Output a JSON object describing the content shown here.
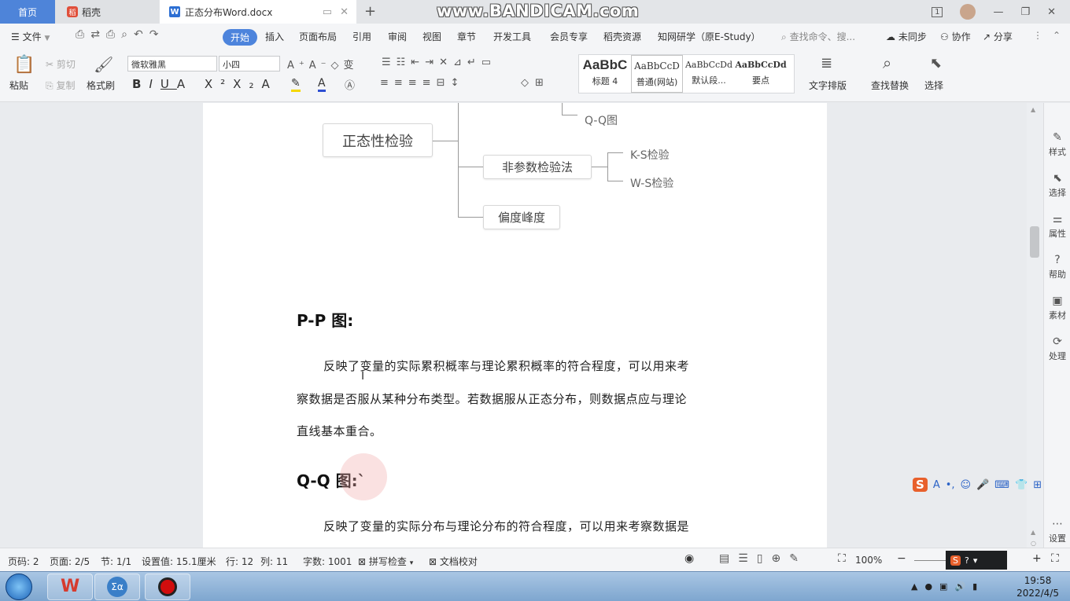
{
  "titlebar": {
    "tab_home": "首页",
    "tab_daoke": "稻壳",
    "tab_doc": "正态分布Word.docx",
    "tab_add": "+",
    "watermark": "www.BANDICAM.com",
    "window_controls": {
      "pages": "1",
      "minimize": "—",
      "restore": "❐",
      "close": "✕"
    }
  },
  "menu": {
    "file": "文件",
    "items": [
      "开始",
      "插入",
      "页面布局",
      "引用",
      "审阅",
      "视图",
      "章节",
      "开发工具",
      "会员专享",
      "稻壳资源",
      "知网研学（原E-Study）"
    ],
    "search": "查找命令、搜...",
    "unsync": "未同步",
    "collab": "协作",
    "share": "分享"
  },
  "ribbon": {
    "paste": "粘贴",
    "cut": "剪切",
    "copy": "复制",
    "format_painter": "格式刷",
    "font_name": "微软雅黑",
    "font_size": "小四",
    "styles": [
      {
        "preview": "AaBbC",
        "label": "标题 4"
      },
      {
        "preview": "AaBbCcD",
        "label": "普通(网站)"
      },
      {
        "preview": "AaBbCcDd",
        "label": "默认段..."
      },
      {
        "preview": "AaBbCcDd",
        "label": "要点"
      }
    ],
    "text_layout": "文字排版",
    "find_replace": "查找替换",
    "select": "选择"
  },
  "document": {
    "mindmap": {
      "root": "正态性检验",
      "qq_leaf": "Q-Q图",
      "nonparam": "非参数检验法",
      "ks": "K-S检验",
      "ws": "W-S检验",
      "skew": "偏度峰度"
    },
    "pp_heading": "P-P 图:",
    "pp_lines": [
      "反映了变量的实际累积概率与理论累积概率的符合程度，可以用来考",
      "察数据是否服从某种分布类型。若数据服从正态分布，则数据点应与理论",
      "直线基本重合。"
    ],
    "qq_heading": "Q-Q 图:`",
    "qq_line": "反映了变量的实际分布与理论分布的符合程度，可以用来考察数据是"
  },
  "sidebar": {
    "items": [
      "样式",
      "选择",
      "属性",
      "帮助",
      "素材",
      "处理"
    ],
    "settings": "设置"
  },
  "statusbar": {
    "page_code": "页码: 2",
    "page": "页面: 2/5",
    "section": "节: 1/1",
    "setting": "设置值: 15.1厘米",
    "row": "行: 12",
    "col": "列: 11",
    "words": "字数: 1001",
    "spell": "拼写检查",
    "proof": "文档校对",
    "zoom": "100%"
  },
  "taskbar": {
    "time": "19:58",
    "date": "2022/4/5"
  },
  "colors": {
    "accent": "#4d84dc",
    "wps_red": "#d63b2f"
  }
}
